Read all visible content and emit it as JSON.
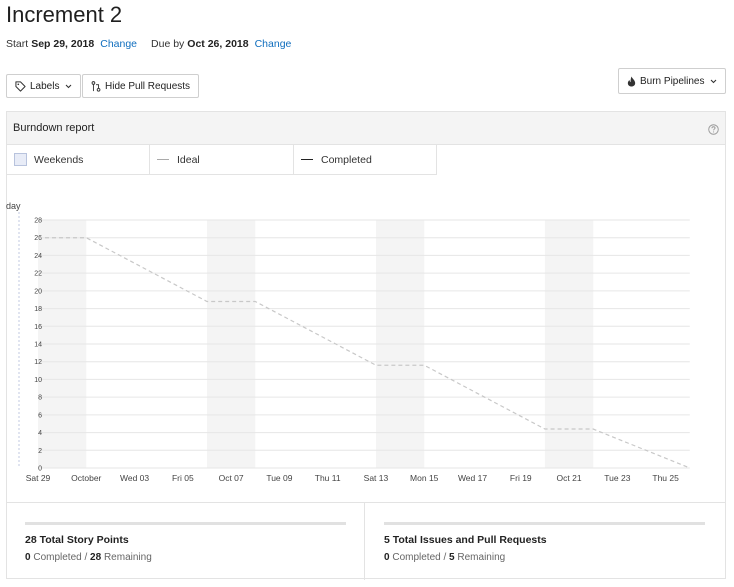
{
  "header": {
    "title": "Increment 2",
    "start_label": "Start",
    "start_date": "Sep 29, 2018",
    "start_change": "Change",
    "due_label": "Due by",
    "due_date": "Oct 26, 2018",
    "due_change": "Change"
  },
  "toolbar": {
    "labels_button": "Labels",
    "hide_pr_button": "Hide Pull Requests",
    "burn_button": "Burn Pipelines"
  },
  "report": {
    "title": "Burndown report",
    "y_axis_fragment": "day",
    "legend": [
      "Weekends",
      "Ideal",
      "Completed"
    ]
  },
  "chart_data": {
    "type": "line",
    "x_tick_labels": [
      "Sat 29",
      "October",
      "Wed 03",
      "Fri 05",
      "Oct 07",
      "Tue 09",
      "Thu 11",
      "Sat 13",
      "Mon 15",
      "Wed 17",
      "Fri 19",
      "Oct 21",
      "Tue 23",
      "Thu 25"
    ],
    "y_ticks": [
      0,
      2,
      4,
      6,
      8,
      10,
      12,
      14,
      16,
      18,
      20,
      22,
      24,
      26,
      28
    ],
    "ylim": [
      0,
      28
    ],
    "weekend_bands": [
      [
        0,
        2
      ],
      [
        7,
        9
      ],
      [
        14,
        16
      ],
      [
        21,
        23
      ]
    ],
    "series": [
      {
        "name": "Ideal",
        "line": "dashed",
        "color": "#c8c8c8",
        "x": [
          0,
          2,
          7,
          9,
          14,
          16,
          21,
          23,
          27
        ],
        "y": [
          26,
          26,
          18.8,
          18.8,
          11.6,
          11.6,
          4.4,
          4.4,
          0
        ]
      }
    ]
  },
  "stats": {
    "left": {
      "title": "28 Total Story Points",
      "completed_num": "0",
      "completed_label": "Completed /",
      "remaining_num": "28",
      "remaining_label": "Remaining"
    },
    "right": {
      "title": "5 Total Issues and Pull Requests",
      "completed_num": "0",
      "completed_label": "Completed /",
      "remaining_num": "5",
      "remaining_label": "Remaining"
    }
  },
  "colors": {
    "link": "#106ebe",
    "weekend_band": "#f4f4f4",
    "grid": "#e6e6e6",
    "axis": "#c2c8e0"
  }
}
